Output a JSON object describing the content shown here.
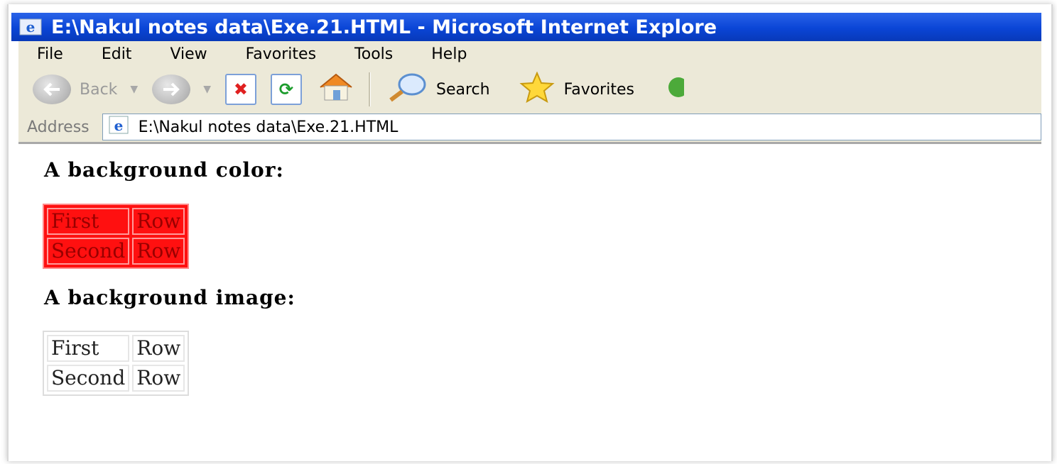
{
  "window": {
    "title": "E:\\Nakul notes data\\Exe.21.HTML - Microsoft Internet Explore"
  },
  "menu": [
    "File",
    "Edit",
    "View",
    "Favorites",
    "Tools",
    "Help"
  ],
  "toolbar": {
    "back_label": "Back",
    "search_label": "Search",
    "favorites_label": "Favorites"
  },
  "address": {
    "label": "Address",
    "value": "E:\\Nakul notes data\\Exe.21.HTML"
  },
  "page": {
    "heading1": "A background color:",
    "table1": [
      [
        "First",
        "Row"
      ],
      [
        "Second",
        "Row"
      ]
    ],
    "heading2": "A background image:",
    "table2": [
      [
        "First",
        "Row"
      ],
      [
        "Second",
        "Row"
      ]
    ],
    "table1_bg": "#ff1010"
  },
  "icons": [
    "ie-logo-icon",
    "back-arrow-icon",
    "forward-arrow-icon",
    "stop-icon",
    "refresh-icon",
    "home-icon",
    "search-icon",
    "favorites-star-icon",
    "media-icon"
  ]
}
